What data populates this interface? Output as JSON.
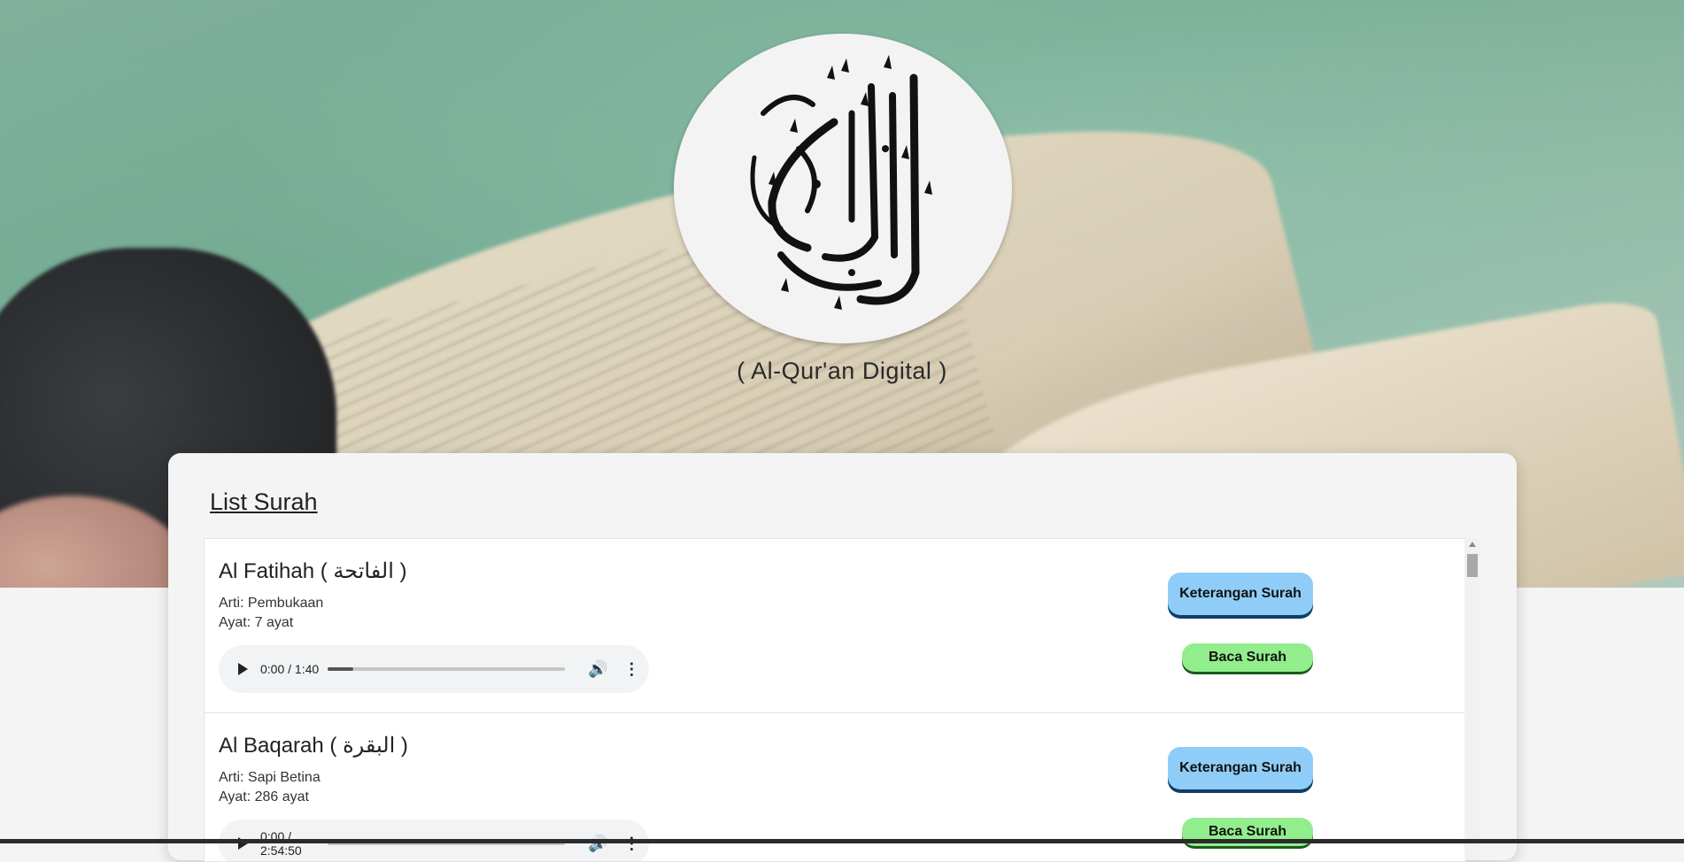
{
  "header": {
    "logo_alt": "Al-Qur'an calligraphy",
    "logo_text": "القرآن الكريم",
    "subtitle": "( Al-Qur'an Digital )"
  },
  "list": {
    "title": "List Surah",
    "items": [
      {
        "title": "Al Fatihah ( الفاتحة )",
        "arti": "Arti: Pembukaan",
        "ayat": "Ayat: 7 ayat",
        "audio_time": "0:00 / 1:40",
        "audio_progress": 0.11,
        "info_label": "Keterangan Surah",
        "read_label": "Baca Surah"
      },
      {
        "title": "Al Baqarah ( البقرة )",
        "arti": "Arti: Sapi Betina",
        "ayat": "Ayat: 286 ayat",
        "audio_time": "0:00 / 2:54:50",
        "audio_progress": 0.0,
        "info_label": "Keterangan Surah",
        "read_label": "Baca Surah"
      }
    ]
  },
  "colors": {
    "info_button": "#8fcdf8",
    "read_button": "#92ee8d"
  },
  "icons": [
    "play-icon",
    "volume-icon",
    "more-options-icon",
    "scroll-up-icon"
  ]
}
